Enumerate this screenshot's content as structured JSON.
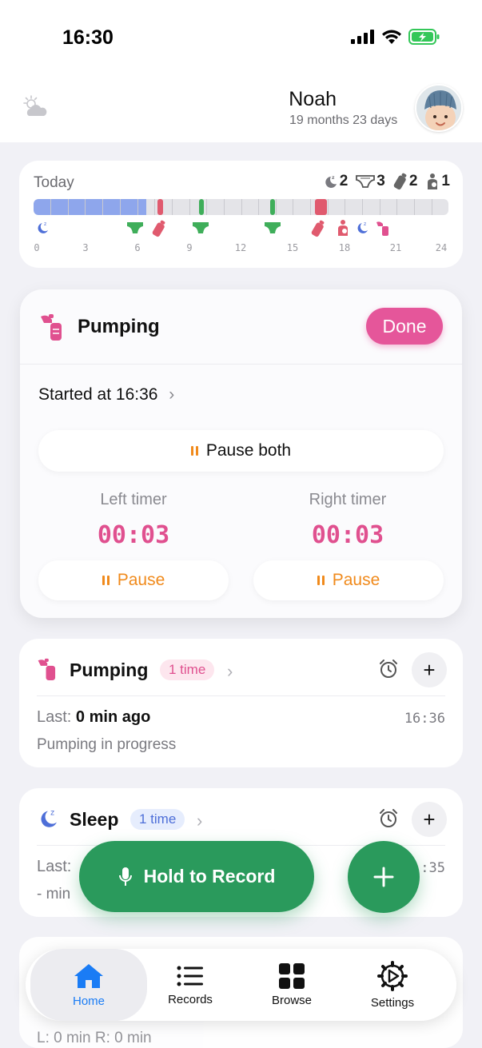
{
  "status_bar": {
    "time": "16:30"
  },
  "header": {
    "name": "Noah",
    "age": "19 months 23 days"
  },
  "today": {
    "label": "Today",
    "counts": [
      {
        "icon": "sleep-icon",
        "value": "2"
      },
      {
        "icon": "diaper-icon",
        "value": "3"
      },
      {
        "icon": "bottle-icon",
        "value": "2"
      },
      {
        "icon": "nursing-icon",
        "value": "1"
      }
    ],
    "hours": [
      "0",
      "3",
      "6",
      "9",
      "12",
      "15",
      "18",
      "21",
      "24"
    ]
  },
  "active": {
    "title": "Pumping",
    "done_label": "Done",
    "started": "Started at 16:36",
    "pause_both": "Pause both",
    "left_label": "Left timer",
    "right_label": "Right timer",
    "left_value": "00:03",
    "right_value": "00:03",
    "pause_label": "Pause"
  },
  "cards": [
    {
      "title": "Pumping",
      "badge": "1 time",
      "last_prefix": "Last:",
      "last_value": "0 min",
      "last_suffix": "ago",
      "time": "16:36",
      "note": "Pumping in progress"
    },
    {
      "title": "Sleep",
      "badge": "1 time",
      "last_prefix": "Last:",
      "time": ":35",
      "note": "- min"
    }
  ],
  "ghost": {
    "line": "L: 0 min R: 0 min"
  },
  "actions": {
    "hold_to_record": "Hold to Record"
  },
  "tabs": [
    {
      "label": "Home"
    },
    {
      "label": "Records"
    },
    {
      "label": "Browse"
    },
    {
      "label": "Settings"
    }
  ],
  "colors": {
    "pink": "#e5569a",
    "green": "#2a9a5c",
    "sleep_blue": "#8ea6ec",
    "orange": "#f08a1c",
    "tab_blue": "#1a7cf5"
  }
}
